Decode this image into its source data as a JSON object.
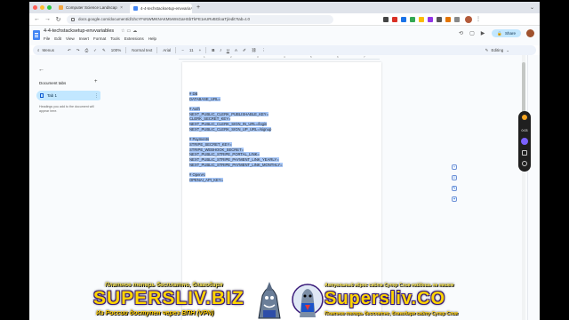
{
  "browser": {
    "tabs": [
      {
        "label": "Computer Science Landscap",
        "active": false
      },
      {
        "label": "4-4-techstacksetup-envvaria",
        "active": true
      }
    ],
    "new_tab": "+",
    "url": "docs.google.com/document/d/1hcYFsNWMKNAKMtvWsGaHSbTkFE1eURvBGloaTj/edit?tab=t.0"
  },
  "doc": {
    "title": "4-4-techstacksetup-envvariables",
    "menu": [
      "File",
      "Edit",
      "View",
      "Insert",
      "Format",
      "Tools",
      "Extensions",
      "Help"
    ],
    "share_label": "Share"
  },
  "toolbar": {
    "search_label": "Menus",
    "zoom": "100%",
    "style": "Normal text",
    "font": "Arial",
    "size": "11",
    "mode": "Editing"
  },
  "sidebar": {
    "heading": "Document tabs",
    "tab_label": "Tab 1",
    "hint": "Headings you add to the document will appear here."
  },
  "ruler": [
    "1",
    "2",
    "3",
    "4",
    "5",
    "6",
    "7"
  ],
  "content": [
    "# DB",
    "DATABASE_URL=",
    "",
    "# Auth",
    "NEXT_PUBLIC_CLERK_PUBLISHABLE_KEY=",
    "CLERK_SECRET_KEY=",
    "NEXT_PUBLIC_CLERK_SIGN_IN_URL=/login",
    "NEXT_PUBLIC_CLERK_SIGN_UP_URL=/signup",
    "",
    "# Payments",
    "STRIPE_SECRET_KEY=",
    "STRIPE_WEBHOOK_SECRET=",
    "NEXT_PUBLIC_STRIPE_PORTAL_LINK=",
    "NEXT_PUBLIC_STRIPE_PAYMENT_LINK_YEARLY=",
    "NEXT_PUBLIC_STRIPE_PAYMENT_LINK_MONTHLY=",
    "",
    "# OpenAI",
    "OPENAI_API_KEY="
  ],
  "recorder": {
    "time": "0:03"
  },
  "watermark": {
    "top_left": "Платное теперь бесплатно, благодаря",
    "brand_left": "SUPERSLIV.BIZ",
    "bottom_left": "Из России доступен через ВПН (VPN)",
    "top_right": "Актуальный адрес сайта Супер Слив найдешь на нашем",
    "brand_right": "Supersliv.CO",
    "bottom_right": "Платное теперь бесплатно, благодаря сайту Супер Слив"
  },
  "colors": {
    "selection": "#a7c7f8",
    "share_bg": "#c2e7ff",
    "watermark_yellow": "#ffd500",
    "docs_blue": "#4285f4"
  }
}
